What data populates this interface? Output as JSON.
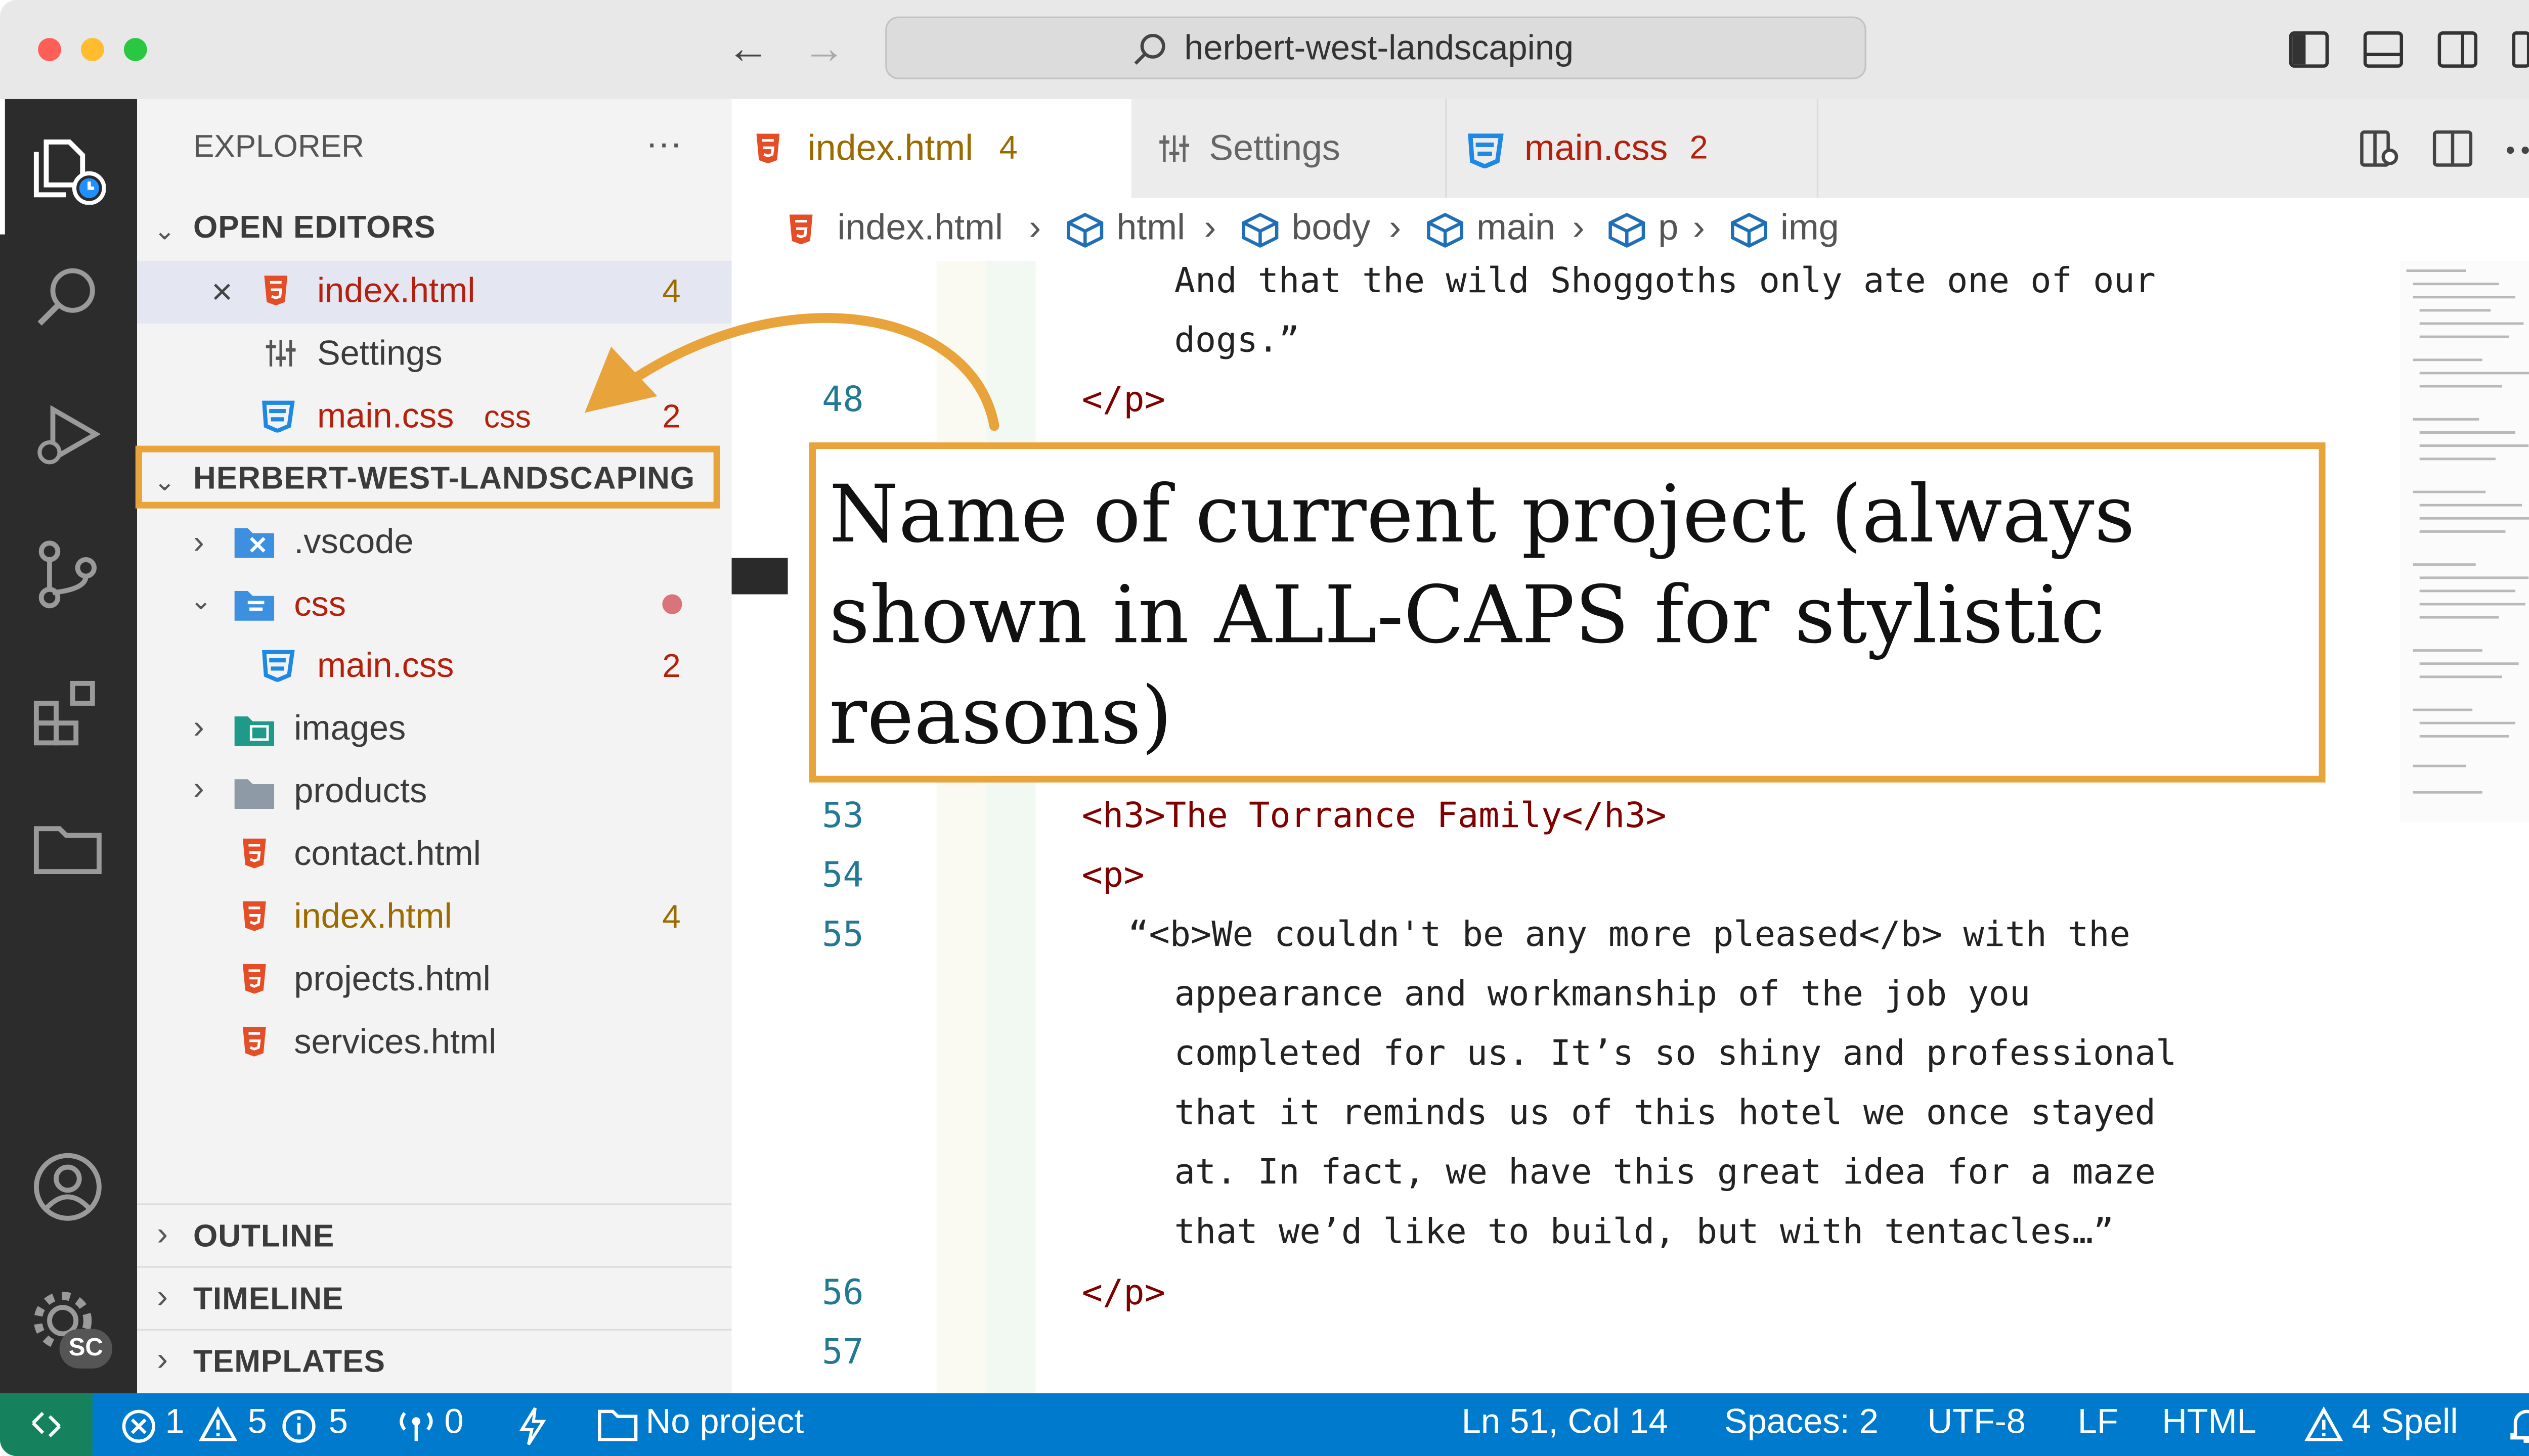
{
  "window": {
    "search_text": "herbert-west-landscaping",
    "colors": {
      "close": "#ff5f57",
      "minimize": "#febc2e",
      "zoom": "#28c840",
      "accent": "#007acc",
      "annotation": "#e8a33a"
    }
  },
  "activity_bar": {
    "account_label": "SC"
  },
  "sidebar": {
    "title": "EXPLORER",
    "more_label": "···",
    "open_editors": {
      "heading": "OPEN EDITORS",
      "items": [
        {
          "name": "index.html",
          "badge": "4",
          "close": "×"
        },
        {
          "name": "Settings"
        },
        {
          "name": "main.css",
          "suffix": "css",
          "badge": "2"
        }
      ]
    },
    "project": {
      "heading": "HERBERT-WEST-LANDSCAPING",
      "items": [
        {
          "name": ".vscode"
        },
        {
          "name": "css"
        },
        {
          "name": "main.css",
          "badge": "2"
        },
        {
          "name": "images"
        },
        {
          "name": "products"
        },
        {
          "name": "contact.html"
        },
        {
          "name": "index.html",
          "badge": "4"
        },
        {
          "name": "projects.html"
        },
        {
          "name": "services.html"
        }
      ]
    },
    "panels": [
      "OUTLINE",
      "TIMELINE",
      "TEMPLATES"
    ]
  },
  "tabs": [
    {
      "label": "index.html",
      "badge": "4"
    },
    {
      "label": "Settings"
    },
    {
      "label": "main.css",
      "badge": "2"
    }
  ],
  "breadcrumb": [
    "index.html",
    "html",
    "body",
    "main",
    "p",
    "img"
  ],
  "editor": {
    "lines": [
      {
        "num": "",
        "text": "And that the wild Shoggoths only ate one of our"
      },
      {
        "num": "",
        "text": "dogs.”"
      },
      {
        "num": "48",
        "text": "</p>"
      },
      {
        "num": "53",
        "text": "<h3>The Torrance Family</h3>"
      },
      {
        "num": "54",
        "text": "<p>"
      },
      {
        "num": "55",
        "text": "“<b>We couldn't be any more pleased</b> with the"
      },
      {
        "num": "",
        "text": "appearance and workmanship of the job you"
      },
      {
        "num": "",
        "text": "completed for us. It’s so shiny and professional"
      },
      {
        "num": "",
        "text": "that it reminds us of this hotel we once stayed"
      },
      {
        "num": "",
        "text": "at. In fact, we have this great idea for a maze"
      },
      {
        "num": "",
        "text": "that we’d like to build, but with tentacles…”"
      },
      {
        "num": "56",
        "text": "</p>"
      },
      {
        "num": "57",
        "text": ""
      }
    ]
  },
  "annotation": {
    "text": "Name of current project (always shown in ALL-CAPS for stylistic reasons)"
  },
  "status_bar": {
    "errors": "1",
    "warnings": "5",
    "infos": "5",
    "ports": "0",
    "folder": "No project",
    "position": "Ln 51, Col 14",
    "spaces": "Spaces: 2",
    "encoding": "UTF-8",
    "eol": "LF",
    "language": "HTML",
    "spell": "4 Spell"
  }
}
